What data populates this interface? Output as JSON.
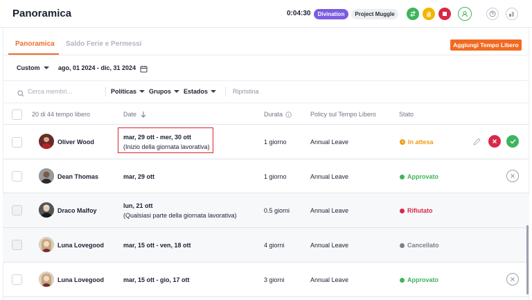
{
  "header": {
    "title": "Panoramica",
    "timer": "0:04:30",
    "workspace_badge": "Divination",
    "project_badge": "Project Muggle"
  },
  "tabs": [
    {
      "label": "Panoramica",
      "active": true
    },
    {
      "label": "Saldo Ferie e Permessi",
      "active": false
    }
  ],
  "add_button": "Aggiungi Tempo Libero",
  "range": {
    "select": "Custom",
    "dates": "ago, 01 2024 - dic, 31 2024"
  },
  "filters": {
    "search_placeholder": "Cerca membri...",
    "policies": "Políticas",
    "groups": "Grupos",
    "states": "Estados",
    "reset": "Ripristina"
  },
  "table": {
    "headers": {
      "count": "20 di 44 tempo libero",
      "date": "Date",
      "duration": "Durata",
      "policy": "Policy sul Tempo Libero",
      "status": "Stato"
    },
    "rows": [
      {
        "name": "Oliver Wood",
        "date_main": "mar, 29 ott - mer, 30 ott",
        "date_sub": "(Inizio della giornata lavorativa)",
        "duration": "1 giorno",
        "policy": "Annual Leave",
        "status": "In attesa"
      },
      {
        "name": "Dean Thomas",
        "date_main": "mar, 29 ott",
        "date_sub": "",
        "duration": "1 giorno",
        "policy": "Annual Leave",
        "status": "Approvato"
      },
      {
        "name": "Draco Malfoy",
        "date_main": "lun, 21 ott",
        "date_sub": "(Qualsiasi parte della giornata lavorativa)",
        "duration": "0.5 giorni",
        "policy": "Annual Leave",
        "status": "Rifiutato"
      },
      {
        "name": "Luna Lovegood",
        "date_main": "mar, 15 ott - ven, 18 ott",
        "date_sub": "",
        "duration": "4 giorni",
        "policy": "Annual Leave",
        "status": "Cancellato"
      },
      {
        "name": "Luna Lovegood",
        "date_main": "mar, 15 ott - gio, 17 ott",
        "date_sub": "",
        "duration": "3 giorni",
        "policy": "Annual Leave",
        "status": "Approvato"
      }
    ]
  },
  "colors": {
    "accent": "#f26a21",
    "pending": "#f39c12",
    "approved": "#3fb45c",
    "rejected": "#d92848",
    "cancelled": "#7a7f8a"
  }
}
